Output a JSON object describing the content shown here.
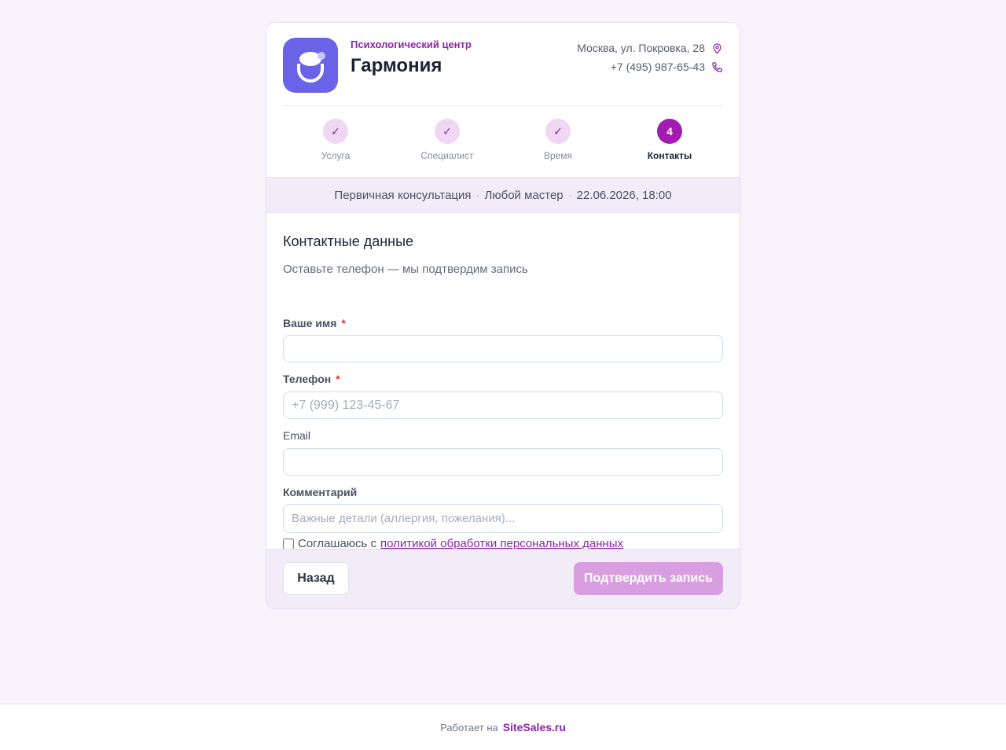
{
  "header": {
    "subtitle": "Психологический центр",
    "title": "Гармония",
    "address": "Москва, ул. Покровка, 28",
    "phone": "+7 (495) 987-65-43"
  },
  "steps": [
    {
      "label": "Услуга",
      "state": "done"
    },
    {
      "label": "Специалист",
      "state": "done"
    },
    {
      "label": "Время",
      "state": "done"
    },
    {
      "label": "Контакты",
      "state": "active",
      "number": "4"
    }
  ],
  "summary": {
    "service": "Первичная консультация",
    "master": "Любой мастер",
    "datetime": "22.06.2026, 18:00",
    "separator": "·"
  },
  "form": {
    "title": "Контактные данные",
    "subtitle": "Оставьте телефон — мы подтвердим запись",
    "name_label": "Ваше имя",
    "name_value": "",
    "phone_label": "Телефон",
    "phone_placeholder": "+7 (999) 123-45-67",
    "email_label": "Email",
    "email_value": "",
    "comment_label": "Комментарий",
    "comment_placeholder": "Важные детали (аллергия, пожелания)...",
    "required_mark": "*",
    "consent_text": "Соглашаюсь с",
    "consent_link": "политикой обработки персональных данных"
  },
  "actions": {
    "back": "Назад",
    "confirm": "Подтвердить запись"
  },
  "footer": {
    "powered_by": "Работает на",
    "brand": "SiteSales.ru"
  },
  "colors": {
    "accent": "#a21caf",
    "logo": "#6a63e8",
    "confirm_disabled": "#d79ee0"
  }
}
